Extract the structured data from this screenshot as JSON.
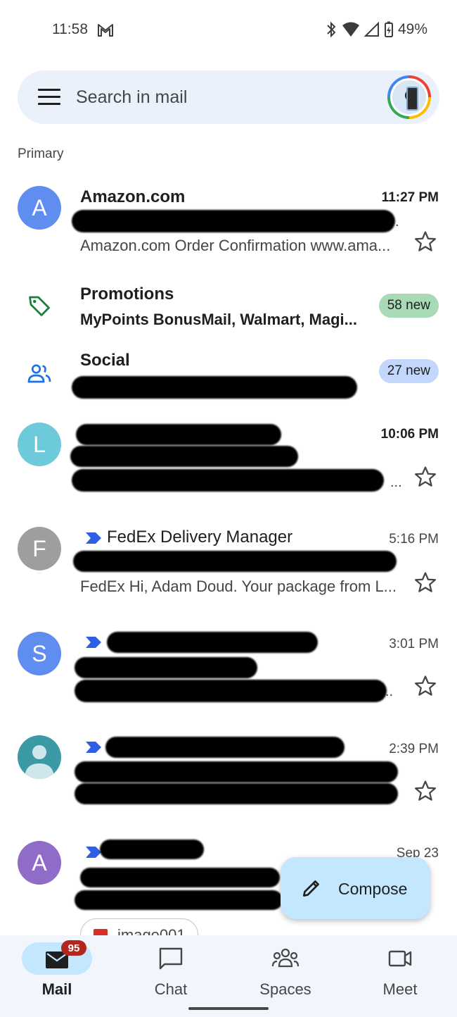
{
  "status_bar": {
    "time": "11:58",
    "battery": "49%"
  },
  "search": {
    "placeholder": "Search in mail"
  },
  "section_label": "Primary",
  "emails": [
    {
      "avatar_letter": "A",
      "avatar_color": "#5f8ef0",
      "sender": "Amazon.com",
      "time": "11:27 PM",
      "snippet": "Amazon.com Order Confirmation www.ama...",
      "unread": true
    },
    {
      "avatar_letter": "L",
      "avatar_color": "#6dcadb",
      "sender": "",
      "time": "10:06 PM",
      "snippet": "",
      "unread": true
    },
    {
      "avatar_letter": "F",
      "avatar_color": "#9e9e9e",
      "sender": "FedEx Delivery Manager",
      "time": "5:16 PM",
      "snippet": "FedEx Hi, Adam Doud. Your package from L...",
      "unread": false
    },
    {
      "avatar_letter": "S",
      "avatar_color": "#5f8ef0",
      "sender": "",
      "time": "3:01 PM",
      "snippet": "",
      "unread": false
    },
    {
      "avatar_letter": "",
      "avatar_color": "#3b9aa6",
      "sender": "",
      "time": "2:39 PM",
      "snippet": "",
      "unread": false
    },
    {
      "avatar_letter": "A",
      "avatar_color": "#8e6cc8",
      "sender": "",
      "time": "Sep 23",
      "snippet": "",
      "unread": false,
      "attachment": "image001"
    }
  ],
  "categories": [
    {
      "name": "Promotions",
      "snippet": "MyPoints BonusMail, Walmart, Magi...",
      "badge": "58 new",
      "badge_color": "#a8dab5"
    },
    {
      "name": "Social",
      "snippet": "",
      "badge": "27 new",
      "badge_color": "#c2d7fb"
    }
  ],
  "compose": {
    "label": "Compose"
  },
  "bottom_nav": {
    "items": [
      {
        "label": "Mail",
        "badge": "95"
      },
      {
        "label": "Chat"
      },
      {
        "label": "Spaces"
      },
      {
        "label": "Meet"
      }
    ]
  },
  "colors": {
    "accent": "#c2e7ff",
    "surface": "#eaf1fb",
    "important_marker": "#2f5ee6"
  }
}
